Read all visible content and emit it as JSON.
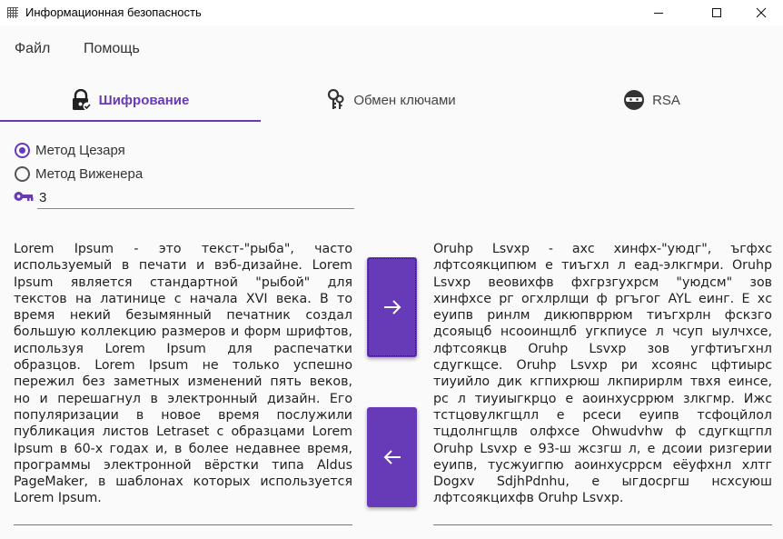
{
  "window": {
    "title": "Информационная безопасность"
  },
  "menu": {
    "file": "Файл",
    "help": "Помощь"
  },
  "tabs": [
    {
      "label": "Шифрование",
      "icon": "lock-icon",
      "active": true
    },
    {
      "label": "Обмен ключами",
      "icon": "key-exchange-icon",
      "active": false
    },
    {
      "label": "RSA",
      "icon": "ninja-icon",
      "active": false
    }
  ],
  "methods": [
    {
      "label": "Метод Цезаря",
      "checked": true
    },
    {
      "label": "Метод Виженера",
      "checked": false
    }
  ],
  "key": {
    "value": "3"
  },
  "plaintext": "Lorem Ipsum - это текст-\"рыба\", часто используемый в печати и вэб-дизайне. Lorem Ipsum является стандартной \"рыбой\" для текстов на латинице с начала XVI века. В то время некий безымянный печатник создал большую коллекцию размеров и форм шрифтов, используя Lorem Ipsum для распечатки образцов. Lorem Ipsum не только успешно пережил без заметных изменений пять веков, но и перешагнул в электронный дизайн. Его популяризации в новое время послужили публикация листов Letraset с образцами Lorem Ipsum в 60-х годах и, в более недавнее время, программы электронной вёрстки типа Aldus PageMaker, в шаблонах которых используется Lorem Ipsum.",
  "ciphertext": "Oruhp Lsvxp - ахс хинфх-\"уюдг\", ъгфхс лфтсоякципюм е тиъгхл л еад-элкгмри. Oruhp Lsvxp веовихфв фхгрзгухрсм \"уюдсм\" зов хинфхсе рг огхлрлщи ф ргъгог AYL еинг. Е хс еуипв ринлм дикюпвррюм тиъгхрлн фскзго дсояыцб нсооинщлб угкпиусе л чсуп ыулчхсе, лфтсоякцв Oruhp Lsvxp зов угфтиъгхнл сдугкщсе. Oruhp Lsvxp ри хсоянс цфтиырс тиуийло дик кгпихрюш лкпирирлм твхя еинсе, рс л тиуиыгкрцо е аоинхусррюм злкгмр. Ижс тстцовулкгщлл е рсеси еуипв тсфоцйлол тцдолнгщлв олфхсе Ohwudvhw ф сдугкщгпл Oruhp Lsvxp е 93-ш жсзгш л, е дсоии ризгерии еуипв, тусжуигпю аоинхусррсм еёуфхнл хлтг Dogxv SdjhPdnhu, е ыгдосргш нсхсуюш лфтсоякцихфв Oruhp Lsvxp.",
  "colors": {
    "accent": "#673ab7"
  },
  "buttons": {
    "encrypt_icon": "arrow-right-icon",
    "decrypt_icon": "arrow-left-icon"
  }
}
